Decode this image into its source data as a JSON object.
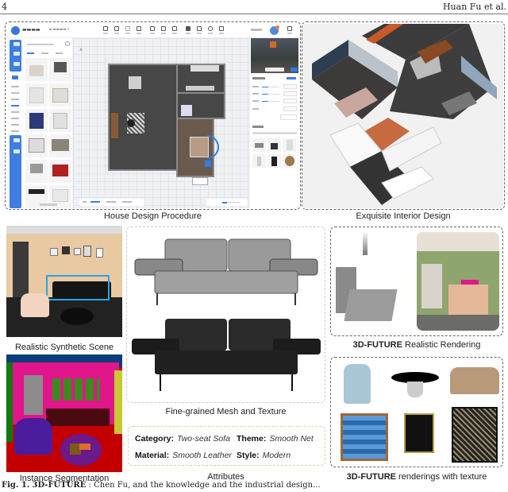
{
  "header": {
    "page_number": "4",
    "authors": "Huan Fu et al."
  },
  "panels": {
    "house_design": {
      "caption": "House Design Procedure"
    },
    "interior": {
      "caption": "Exquisite Interior Design"
    },
    "synthetic_scene": {
      "caption": "Realistic Synthetic Scene"
    },
    "segmentation": {
      "caption": "Instance Segmentation"
    },
    "mesh": {
      "caption": "Fine-grained Mesh and Texture"
    },
    "attributes": {
      "caption": "Attributes",
      "items": [
        {
          "key": "Category:",
          "value": "Two-seat Sofa"
        },
        {
          "key": "Theme:",
          "value": "Smooth Net"
        },
        {
          "key": "Material:",
          "value": "Smooth Leather"
        },
        {
          "key": "Style:",
          "value": "Modern"
        }
      ]
    },
    "realistic_rendering": {
      "caption_bold": "3D-FUTURE",
      "caption_rest": " Realistic Rendering"
    },
    "texture_renderings": {
      "caption_bold": "3D-FUTURE",
      "caption_rest": " renderings with texture"
    }
  },
  "figure_caption": {
    "label": "Fig. 1.",
    "bold": "3D-FUTURE",
    "text": " : Chen Fu, and the knowledge and the industrial design..."
  },
  "colors": {
    "accent_blue": "#3f7de0",
    "selection_blue": "#2ea3e8",
    "seg_magenta": "#e0168a",
    "seg_red": "#c20000",
    "seg_purple": "#5a1fa8"
  }
}
